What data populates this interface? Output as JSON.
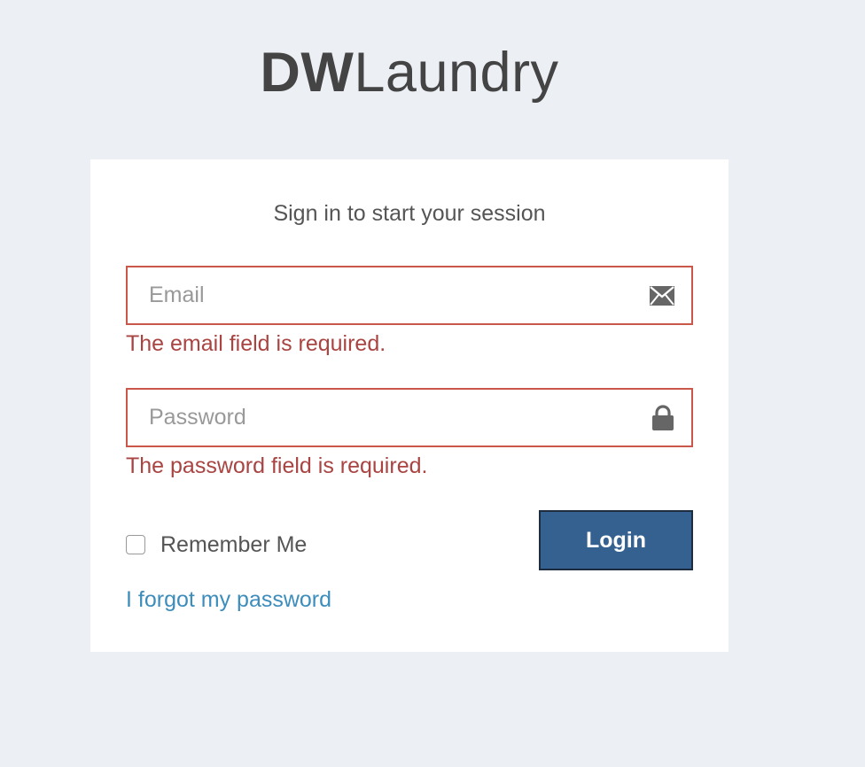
{
  "logo": {
    "bold": "DW",
    "light": "Laundry"
  },
  "login": {
    "message": "Sign in to start your session",
    "email": {
      "placeholder": "Email",
      "value": "",
      "icon": "envelope-icon",
      "error": "The email field is required."
    },
    "password": {
      "placeholder": "Password",
      "value": "",
      "icon": "lock-icon",
      "error": "The password field is required."
    },
    "remember_label": "Remember Me",
    "remember_checked": false,
    "login_label": "Login",
    "forgot_label": "I forgot my password"
  },
  "colors": {
    "background": "#ecf0f5",
    "error": "#a94442",
    "error_border": "#c9574a",
    "button": "#34618f",
    "link": "#3c8dbc"
  }
}
